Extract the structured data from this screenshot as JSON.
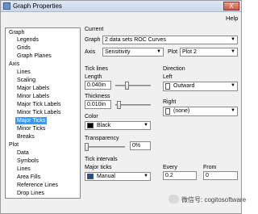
{
  "window": {
    "title": "Graph Properties",
    "close_label": "X",
    "help_label": "Help"
  },
  "tree": {
    "items": [
      {
        "label": "Graph"
      },
      {
        "label": "Legends"
      },
      {
        "label": "Grids"
      },
      {
        "label": "Graph Planes"
      },
      {
        "label": "Axis"
      },
      {
        "label": "Lines"
      },
      {
        "label": "Scaling"
      },
      {
        "label": "Major Labels"
      },
      {
        "label": "Minor Labels"
      },
      {
        "label": "Major Tick Labels"
      },
      {
        "label": "Minor Tick Labels"
      },
      {
        "label": "Major Ticks"
      },
      {
        "label": "Minor Ticks"
      },
      {
        "label": "Breaks"
      },
      {
        "label": "Plot"
      },
      {
        "label": "Data"
      },
      {
        "label": "Symbols"
      },
      {
        "label": "Lines"
      },
      {
        "label": "Area Fills"
      },
      {
        "label": "Reference Lines"
      },
      {
        "label": "Drop Lines"
      }
    ],
    "selected": "Major Ticks"
  },
  "current": {
    "section_label": "Current",
    "graph_label": "Graph",
    "graph_value": "2 data sets ROC Curves",
    "axis_label": "Axis",
    "axis_value": "Sensitivity",
    "plot_label": "Plot",
    "plot_value": "Plot 2"
  },
  "tick_lines": {
    "section_label": "Tick lines",
    "length_label": "Length",
    "length_value": "0.040in",
    "length_level": 0.3,
    "thickness_label": "Thickness",
    "thickness_value": "0.010in",
    "thickness_level": 0.05,
    "color_label": "Color",
    "color_value": "Black",
    "color_hex": "#000000",
    "transparency_label": "Transparency",
    "transparency_value": "0%",
    "transparency_level": 0.0
  },
  "direction": {
    "section_label": "Direction",
    "left_label": "Left",
    "left_value": "Outward",
    "right_label": "Right",
    "right_value": "(none)"
  },
  "tick_intervals": {
    "section_label": "Tick intervals",
    "major_ticks_label": "Major ticks",
    "major_ticks_value": "Manual",
    "every_label": "Every",
    "every_value": "0.2",
    "from_label": "From",
    "from_value": "0"
  },
  "watermark": {
    "text": "微信号: cogitosoftware"
  },
  "colors": {
    "selection": "#3399ff",
    "window_bg": "#f0f0f0"
  }
}
